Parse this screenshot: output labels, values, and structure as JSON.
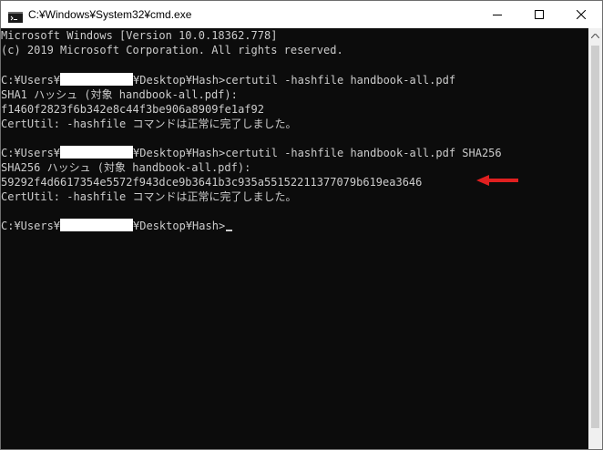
{
  "window": {
    "title": "C:¥Windows¥System32¥cmd.exe",
    "icon": "cmd-icon",
    "caption_buttons": [
      "minimize-icon",
      "maximize-icon",
      "close-icon"
    ]
  },
  "console": {
    "lines": [
      "Microsoft Windows [Version 10.0.18362.778]",
      "(c) 2019 Microsoft Corporation. All rights reserved.",
      "",
      "",
      "SHA1 ハッシュ (対象 handbook-all.pdf):",
      "f1460f2823f6b342e8c44f3be906a8909fe1af92",
      "CertUtil: -hashfile コマンドは正常に完了しました。",
      "",
      "",
      "SHA256 ハッシュ (対象 handbook-all.pdf):",
      "59292f4d6617354e5572f943dce9b3641b3c935a55152211377079b619ea3646",
      "CertUtil: -hashfile コマンドは正常に完了しました。",
      ""
    ],
    "prompt_prefix": "C:¥Users¥",
    "prompt_suffix": "¥Desktop¥Hash>",
    "command_1": "certutil -hashfile handbook-all.pdf",
    "command_2": "certutil -hashfile handbook-all.pdf SHA256",
    "command_3": ""
  },
  "annotation": {
    "arrow_color": "#e02020",
    "arrow_icon": "red-arrow-left-icon"
  },
  "colors": {
    "console_bg": "#0c0c0c",
    "console_fg": "#cccccc",
    "titlebar_bg": "#ffffff"
  }
}
